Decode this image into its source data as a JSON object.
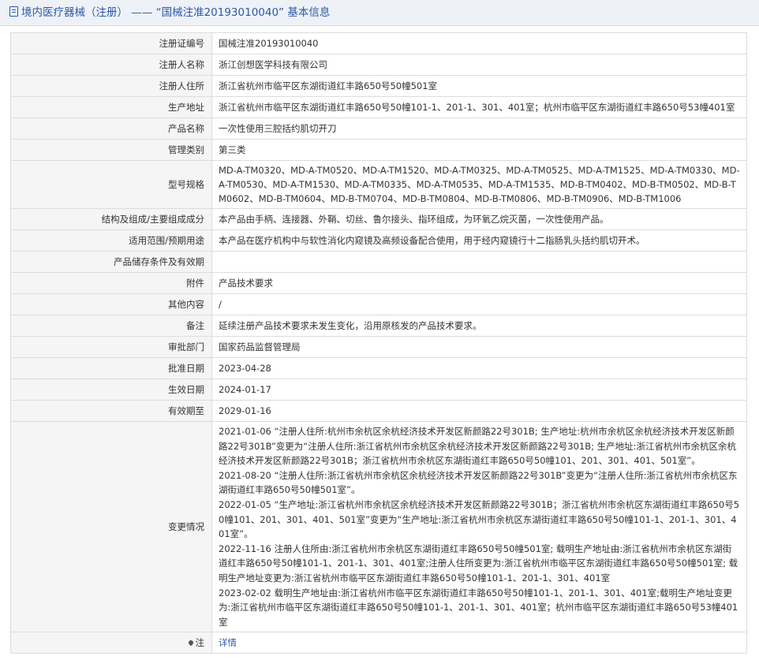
{
  "header": {
    "title": "境内医疗器械（注册） —— “国械注准20193010040” 基本信息"
  },
  "rows": {
    "reg_no": {
      "label": "注册证编号",
      "value": "国械注准20193010040"
    },
    "registrant": {
      "label": "注册人名称",
      "value": "浙江创想医学科技有限公司"
    },
    "reg_address": {
      "label": "注册人住所",
      "value": "浙江省杭州市临平区东湖街道红丰路650号50幢501室"
    },
    "prod_address": {
      "label": "生产地址",
      "value": "浙江省杭州市临平区东湖街道红丰路650号50幢101-1、201-1、301、401室；杭州市临平区东湖街道红丰路650号53幢401室"
    },
    "product_name": {
      "label": "产品名称",
      "value": "一次性使用三腔括约肌切开刀"
    },
    "category": {
      "label": "管理类别",
      "value": "第三类"
    },
    "models": {
      "label": "型号规格",
      "value": "MD-A-TM0320、MD-A-TM0520、MD-A-TM1520、MD-A-TM0325、MD-A-TM0525、MD-A-TM1525、MD-A-TM0330、MD-A-TM0530、MD-A-TM1530、MD-A-TM0335、MD-A-TM0535、MD-A-TM1535、MD-B-TM0402、MD-B-TM0502、MD-B-TM0602、MD-B-TM0604、MD-B-TM0704、MD-B-TM0804、MD-B-TM0806、MD-B-TM0906、MD-B-TM1006"
    },
    "structure": {
      "label": "结构及组成/主要组成成分",
      "value": "本产品由手柄、连接器、外鞘、切丝、鲁尔接头、指环组成，为环氧乙烷灭菌，一次性使用产品。"
    },
    "scope": {
      "label": "适用范围/预期用途",
      "value": "本产品在医疗机构中与软性消化内窥镜及高频设备配合使用，用于经内窥镜行十二指肠乳头括约肌切开术。"
    },
    "storage": {
      "label": "产品储存条件及有效期",
      "value": ""
    },
    "attachment": {
      "label": "附件",
      "value": "产品技术要求"
    },
    "other": {
      "label": "其他内容",
      "value": "/"
    },
    "remark": {
      "label": "备注",
      "value": "延续注册产品技术要求未发生变化，沿用原核发的产品技术要求。"
    },
    "dept": {
      "label": "审批部门",
      "value": "国家药品监督管理局"
    },
    "approve_date": {
      "label": "批准日期",
      "value": "2023-04-28"
    },
    "effective": {
      "label": "生效日期",
      "value": "2024-01-17"
    },
    "expiry": {
      "label": "有效期至",
      "value": "2029-01-16"
    }
  },
  "changes": {
    "label": "变更情况",
    "entries": [
      "2021-01-06 “注册人住所:杭州市余杭区余杭经济技术开发区新颜路22号301B; 生产地址:杭州市余杭区余杭经济技术开发区新颜路22号301B”变更为“注册人住所:浙江省杭州市余杭区余杭经济技术开发区新颜路22号301B; 生产地址:浙江省杭州市余杭区余杭经济技术开发区新颜路22号301B；浙江省杭州市余杭区东湖街道红丰路650号50幢101、201、301、401、501室”。",
      "2021-08-20 “注册人住所:浙江省杭州市余杭区余杭经济技术开发区新颜路22号301B”变更为“注册人住所:浙江省杭州市余杭区东湖街道红丰路650号50幢501室”。",
      "2022-01-05 “生产地址:浙江省杭州市余杭区余杭经济技术开发区新颜路22号301B；浙江省杭州市余杭区东湖街道红丰路650号50幢101、201、301、401、501室”变更为“生产地址:浙江省杭州市余杭区东湖街道红丰路650号50幢101-1、201-1、301、401室”。",
      "2022-11-16 注册人住所由:浙江省杭州市余杭区东湖街道红丰路650号50幢501室; 载明生产地址由:浙江省杭州市余杭区东湖街道红丰路650号50幢101-1、201-1、301、401室;注册人住所变更为:浙江省杭州市临平区东湖街道红丰路650号50幢501室; 载明生产地址变更为:浙江省杭州市临平区东湖街道红丰路650号50幢101-1、201-1、301、401室",
      "2023-02-02 载明生产地址由:浙江省杭州市临平区东湖街道红丰路650号50幢101-1、201-1、301、401室;载明生产地址变更为:浙江省杭州市临平区东湖街道红丰路650号50幢101-1、201-1、301、401室；杭州市临平区东湖街道红丰路650号53幢401室"
    ]
  },
  "note": {
    "label": "注",
    "icon": "location-pin-icon",
    "link": "详情"
  }
}
